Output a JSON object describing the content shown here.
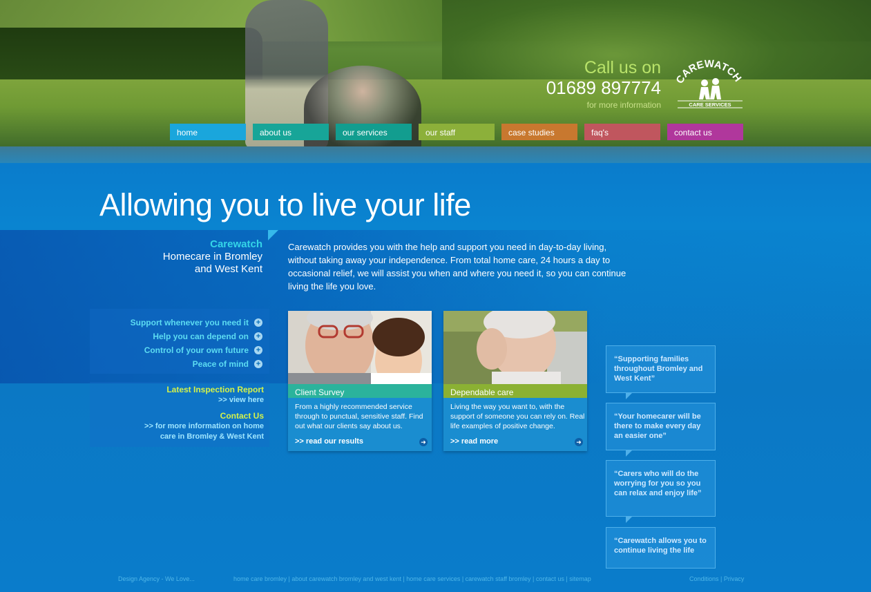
{
  "header": {
    "call_us": "Call us on",
    "phone": "01689 897774",
    "more_info": "for more information",
    "logo_text_main": "CAREWATCH",
    "logo_text_sub": "CARE SERVICES"
  },
  "nav": [
    {
      "label": "home",
      "color": "#1aa6dc"
    },
    {
      "label": "about us",
      "color": "#17a598"
    },
    {
      "label": "our services",
      "color": "#129d8f"
    },
    {
      "label": "our staff",
      "color": "#8cb03a"
    },
    {
      "label": "case studies",
      "color": "#c8782f"
    },
    {
      "label": "faq's",
      "color": "#c0565e"
    },
    {
      "label": "contact us",
      "color": "#b0379c"
    }
  ],
  "main": {
    "headline": "Allowing you to live your life",
    "side_title": "Carewatch",
    "side_sub1": "Homecare in Bromley",
    "side_sub2": "and West Kent",
    "intro": "Carewatch provides you with the help and support you need in day-to-day living, without taking away your independence. From total home care, 24 hours a day to occasional relief, we will assist you when and where you need it, so you can continue living the life you love."
  },
  "side_links": [
    "Support whenever you need it",
    "Help you can depend on",
    "Control of your own future",
    "Peace of mind"
  ],
  "inspection": {
    "title": "Latest Inspection Report",
    "link": ">> view here",
    "contact_title": "Contact Us",
    "contact_link1": ">> for more information on home",
    "contact_link2": "care in Bromley & West Kent"
  },
  "cards": [
    {
      "label": "Client Survey",
      "label_color": "#2bb39c",
      "body": "From a highly recommended service through to punctual, sensitive staff. Find out what our clients say about us.",
      "more": ">> read our results"
    },
    {
      "label": "Dependable care",
      "label_color": "#8bb133",
      "body": "Living the way you want to, with the support of someone you can rely on. Real life examples of positive change.",
      "more": ">> read more"
    }
  ],
  "quotes": [
    "“Supporting families throughout Bromley and West Kent”",
    "“Your homecarer will be there to make every day an easier one”",
    "“Carers who will do the worrying for you so you can relax and enjoy life”",
    "“Carewatch allows you to continue living the life"
  ],
  "footer": {
    "agency": "Design Agency - We Love...",
    "links": "home care bromley | about carewatch bromley and west kent | home care services | carewatch staff bromley | contact us | sitemap",
    "legal": "Conditions | Privacy"
  }
}
